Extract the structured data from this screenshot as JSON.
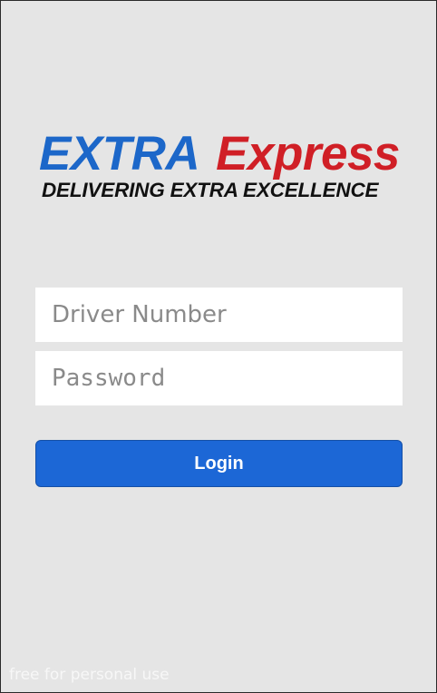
{
  "logo": {
    "word_extra": "EXTRA",
    "word_express": "Express",
    "tagline": "DELIVERING EXTRA EXCELLENCE",
    "colors": {
      "extra": "#1c67c9",
      "express": "#d01f26",
      "tagline": "#111111"
    }
  },
  "form": {
    "driver_number_placeholder": "Driver Number",
    "driver_number_value": "",
    "password_placeholder": "Password",
    "password_value": "",
    "login_label": "Login"
  },
  "watermark": "free for personal use",
  "colors": {
    "background": "#e5e5e5",
    "button": "#1c67d6",
    "field": "#ffffff"
  }
}
